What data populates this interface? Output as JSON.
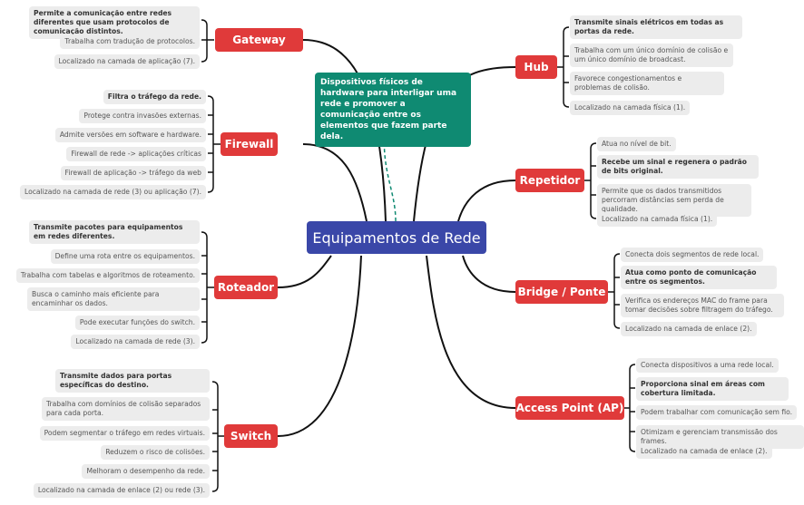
{
  "central": {
    "label": "Equipamentos de Rede",
    "color": "#3a47a8"
  },
  "note": {
    "text": "Dispositivos físicos de hardware para interligar uma rede e promover a comunicação entre os elementos que fazem parte dela.",
    "color": "#0f8a72"
  },
  "branch_color": "#e03a3a",
  "branches": {
    "gateway": {
      "label": "Gateway",
      "items": [
        "Permite a comunicação entre redes diferentes que usam protocolos de comunicação distintos.",
        "Trabalha com tradução de protocolos.",
        "Localizado na camada de aplicação (7)."
      ]
    },
    "firewall": {
      "label": "Firewall",
      "items": [
        "Filtra o tráfego da rede.",
        "Protege contra invasões externas.",
        "Admite versões em software e hardware.",
        "Firewall de rede -> aplicações críticas",
        "Firewall de aplicação -> tráfego da web",
        "Localizado na camada de rede (3) ou aplicação (7)."
      ]
    },
    "roteador": {
      "label": "Roteador",
      "items": [
        "Transmite pacotes para equipamentos em redes diferentes.",
        "Define uma rota entre os equipamentos.",
        "Trabalha com tabelas e algoritmos de roteamento.",
        "Busca o caminho mais eficiente para encaminhar os dados.",
        "Pode executar funções do switch.",
        "Localizado na camada de rede (3)."
      ]
    },
    "switch": {
      "label": "Switch",
      "items": [
        "Transmite dados para portas específicas do destino.",
        "Trabalha com domínios de colisão separados para cada porta.",
        "Podem segmentar o tráfego em redes virtuais.",
        "Reduzem o risco de colisões.",
        "Melhoram o desempenho da rede.",
        "Localizado na camada de enlace (2) ou rede (3)."
      ]
    },
    "hub": {
      "label": "Hub",
      "items": [
        "Transmite sinais elétricos em todas as portas da rede.",
        "Trabalha com um único domínio de colisão e um único domínio de broadcast.",
        "Favorece congestionamentos e problemas de colisão.",
        "Localizado na camada física (1)."
      ]
    },
    "repetidor": {
      "label": "Repetidor",
      "items": [
        "Atua no nível de bit.",
        "Recebe um sinal e regenera o padrão de bits original.",
        "Permite que os dados transmitidos percorram distâncias sem perda de qualidade.",
        "Localizado na camada física (1)."
      ]
    },
    "bridge": {
      "label": "Bridge / Ponte",
      "items": [
        "Conecta dois segmentos de rede local.",
        "Atua como ponto de comunicação entre os segmentos.",
        "Verifica os endereços MAC do frame para tomar decisões sobre filtragem do tráfego.",
        "Localizado na camada de enlace (2)."
      ]
    },
    "ap": {
      "label": "Access Point (AP)",
      "items": [
        "Conecta dispositivos a uma rede local.",
        "Proporciona sinal em áreas com cobertura limitada.",
        "Podem trabalhar com comunicação sem fio.",
        "Otimizam e gerenciam transmissão dos frames.",
        "Localizado na camada de enlace (2)."
      ]
    }
  }
}
